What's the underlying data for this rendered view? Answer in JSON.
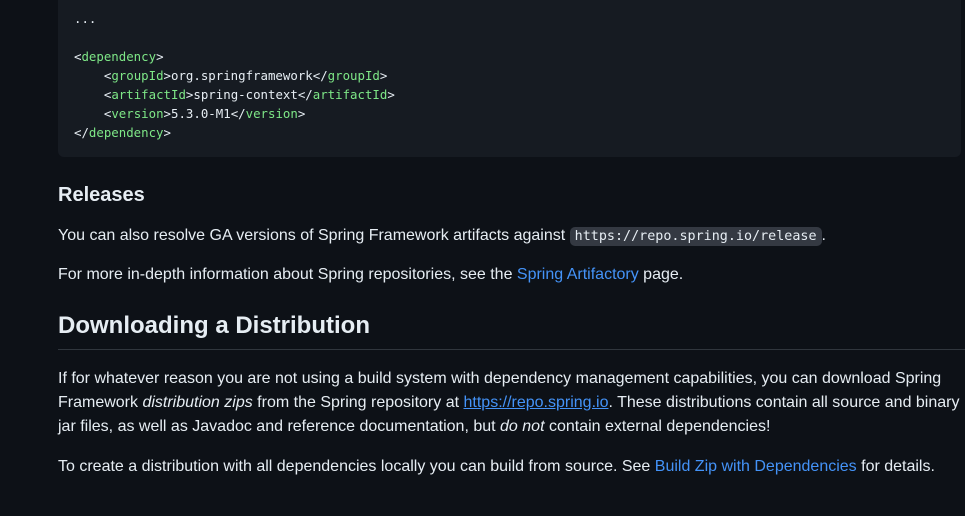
{
  "code": {
    "ellipsis": "...",
    "dep_open_tag": "dependency",
    "group_tag": "groupId",
    "group_value": "org.springframework",
    "artifact_tag": "artifactId",
    "artifact_value": "spring-context",
    "version_tag": "version",
    "version_value": "5.3.0-M1",
    "dep_close_tag": "dependency"
  },
  "releases": {
    "heading": "Releases",
    "p1_text": "You can also resolve GA versions of Spring Framework artifacts against ",
    "p1_code": "https://repo.spring.io/release",
    "p1_end": ".",
    "p2_text": "For more in-depth information about Spring repositories, see the ",
    "p2_link": "Spring Artifactory",
    "p2_end": " page."
  },
  "download": {
    "heading": "Downloading a Distribution",
    "l1": "If for whatever reason you are not using a build system with dependency management capabilities, you can download Spring",
    "l2_a": "Framework ",
    "l2_em": "distribution zips",
    "l2_b": " from the Spring repository at ",
    "l2_link": "https://repo.spring.io",
    "l2_c": ". These distributions contain all source and binary",
    "l3_a": "jar files, as well as Javadoc and reference documentation, but ",
    "l3_em": "do not",
    "l3_b": " contain external dependencies!",
    "p4_text": "To create a distribution with all dependencies locally you can build from source. See ",
    "p4_link": "Build Zip with Dependencies",
    "p4_end": " for details."
  },
  "colors": {
    "background": "#0d1117",
    "code_background": "#161b22",
    "text": "#e6edf3",
    "link": "#4493f8",
    "xml_tag": "#7ee787"
  }
}
